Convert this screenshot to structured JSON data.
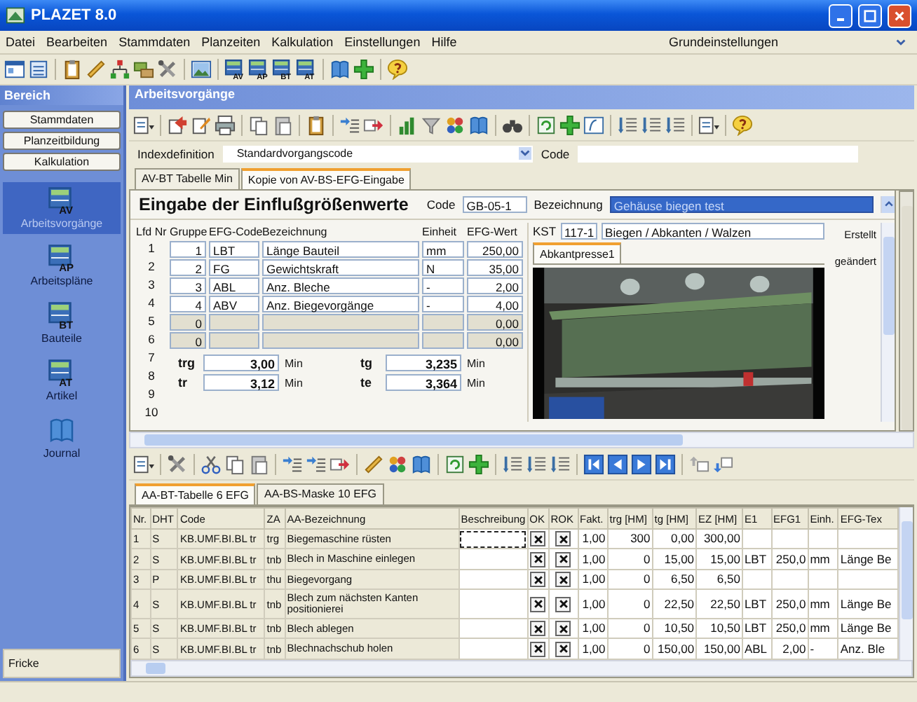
{
  "window": {
    "title": "PLAZET 8.0"
  },
  "menu": [
    "Datei",
    "Bearbeiten",
    "Stammdaten",
    "Planzeiten",
    "Kalkulation",
    "Einstellungen",
    "Hilfe"
  ],
  "profile_select": {
    "value": "Grundeinstellungen"
  },
  "main_toolbar": {
    "module_buttons": [
      {
        "label": "AV"
      },
      {
        "label": "AP"
      },
      {
        "label": "BT"
      },
      {
        "label": "AT"
      }
    ]
  },
  "sidebar": {
    "title": "Bereich",
    "sections": [
      "Stammdaten",
      "Planzeitbildung",
      "Kalkulation"
    ],
    "items": [
      {
        "kind": "module",
        "icon_label": "AV",
        "label": "Arbeitsvorgänge",
        "selected": true
      },
      {
        "kind": "module",
        "icon_label": "AP",
        "label": "Arbeitspläne",
        "selected": false
      },
      {
        "kind": "module",
        "icon_label": "BT",
        "label": "Bauteile",
        "selected": false
      },
      {
        "kind": "module",
        "icon_label": "AT",
        "label": "Artikel",
        "selected": false
      },
      {
        "kind": "book",
        "label": "Journal",
        "selected": false
      }
    ],
    "user": "Fricke"
  },
  "panel": {
    "title": "Arbeitsvorgänge",
    "index": {
      "label": "Indexdefinition",
      "value": "Standardvorgangscode",
      "code_label": "Code"
    },
    "tabs": [
      {
        "label": "AV-BT Tabelle Min",
        "selected": false
      },
      {
        "label": "Kopie von AV-BS-EFG-Eingabe",
        "selected": true
      }
    ],
    "form": {
      "title": "Eingabe der Einflußgrößenwerte",
      "code_label": "Code",
      "code": "GB-05-1",
      "name_label": "Bezeichnung",
      "name": "Gehäuse biegen test",
      "columns": [
        "Lfd Nr",
        "Gruppe",
        "EFG-Code",
        "Bezeichnung",
        "Einheit",
        "EFG-Wert"
      ],
      "rows": [
        {
          "nr": "1",
          "group": "1",
          "code": "LBT",
          "name": "Länge Bauteil",
          "unit": "mm",
          "value": "250,00",
          "disabled": false
        },
        {
          "nr": "2",
          "group": "2",
          "code": "FG",
          "name": "Gewichtskraft",
          "unit": "N",
          "value": "35,00",
          "disabled": false
        },
        {
          "nr": "3",
          "group": "3",
          "code": "ABL",
          "name": "Anz. Bleche",
          "unit": "-",
          "value": "2,00",
          "disabled": false
        },
        {
          "nr": "4",
          "group": "4",
          "code": "ABV",
          "name": "Anz. Biegevorgänge",
          "unit": "-",
          "value": "4,00",
          "disabled": false
        },
        {
          "nr": "5",
          "group": "0",
          "value": "0,00",
          "disabled": true
        },
        {
          "nr": "6",
          "group": "0",
          "value": "0,00",
          "disabled": true
        }
      ],
      "extra_numbers": [
        "7",
        "8",
        "9",
        "10"
      ],
      "times": [
        {
          "label": "trg",
          "value": "3,00",
          "unit": "Min"
        },
        {
          "label": "tr",
          "value": "3,12",
          "unit": "Min"
        },
        {
          "label": "tg",
          "value": "3,235",
          "unit": "Min"
        },
        {
          "label": "te",
          "value": "3,364",
          "unit": "Min"
        }
      ],
      "kst": {
        "label": "KST",
        "code": "117-1",
        "name": "Biegen / Abkanten / Walzen"
      },
      "image_tab": "Abkantpresse1",
      "meta_labels": [
        "Erstellt",
        "geändert"
      ]
    }
  },
  "lower": {
    "tabs": [
      {
        "label": "AA-BT-Tabelle 6 EFG",
        "selected": true
      },
      {
        "label": "AA-BS-Maske 10 EFG",
        "selected": false
      }
    ],
    "grid": {
      "columns": [
        "Nr.",
        "DHT",
        "Code",
        "ZA",
        "AA-Bezeichnung",
        "Beschreibung",
        "OK",
        "ROK",
        "Fakt.",
        "trg [HM]",
        "tg [HM]",
        "EZ [HM]",
        "E1",
        "EFG1",
        "Einh.",
        "EFG-Tex"
      ],
      "rows": [
        {
          "nr": "1",
          "dht": "S",
          "code": "KB.UMF.BI.BL tr",
          "za": "trg",
          "name": "Biegemaschine rüsten",
          "focused": true,
          "ok": true,
          "rok": true,
          "fakt": "1,00",
          "trg": "300",
          "tg": "0,00",
          "ez": "300,00"
        },
        {
          "nr": "2",
          "dht": "S",
          "code": "KB.UMF.BI.BL tr",
          "za": "tnb",
          "name": "Blech in  Maschine einlegen",
          "focused": false,
          "ok": true,
          "rok": true,
          "fakt": "1,00",
          "trg": "0",
          "tg": "15,00",
          "ez": "15,00",
          "e1": "LBT",
          "efg1": "250,0",
          "einh": "mm",
          "efgtext": "Länge Be"
        },
        {
          "nr": "3",
          "dht": "P",
          "code": "KB.UMF.BI.BL tr",
          "za": "thu",
          "name": "Biegevorgang",
          "focused": false,
          "ok": true,
          "rok": true,
          "fakt": "1,00",
          "trg": "0",
          "tg": "6,50",
          "ez": "6,50"
        },
        {
          "nr": "4",
          "dht": "S",
          "code": "KB.UMF.BI.BL tr",
          "za": "tnb",
          "name": "Blech zum nächsten Kanten positionierei",
          "focused": false,
          "ok": true,
          "rok": true,
          "fakt": "1,00",
          "trg": "0",
          "tg": "22,50",
          "ez": "22,50",
          "e1": "LBT",
          "efg1": "250,0",
          "einh": "mm",
          "efgtext": "Länge Be"
        },
        {
          "nr": "5",
          "dht": "S",
          "code": "KB.UMF.BI.BL tr",
          "za": "tnb",
          "name": "Blech ablegen",
          "focused": false,
          "ok": true,
          "rok": true,
          "fakt": "1,00",
          "trg": "0",
          "tg": "10,50",
          "ez": "10,50",
          "e1": "LBT",
          "efg1": "250,0",
          "einh": "mm",
          "efgtext": "Länge Be"
        },
        {
          "nr": "6",
          "dht": "S",
          "code": "KB.UMF.BI.BL tr",
          "za": "tnb",
          "name": "Blechnachschub holen",
          "focused": false,
          "ok": true,
          "rok": true,
          "fakt": "1,00",
          "trg": "0",
          "tg": "150,00",
          "ez": "150,00",
          "e1": "ABL",
          "efg1": "2,00",
          "einh": "-",
          "efgtext": "Anz. Ble"
        }
      ]
    }
  }
}
